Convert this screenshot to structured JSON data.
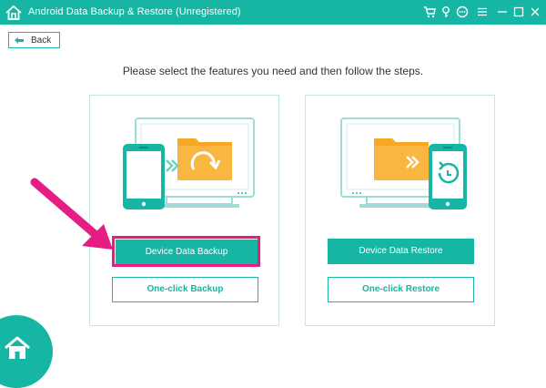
{
  "window": {
    "title": "Android Data Backup & Restore (Unregistered)"
  },
  "toolbar": {
    "back_label": "Back"
  },
  "main": {
    "instruction": "Please select the features you need and then follow the steps."
  },
  "backup_panel": {
    "primary_label": "Device Data Backup",
    "secondary_label": "One-click Backup"
  },
  "restore_panel": {
    "primary_label": "Device Data Restore",
    "secondary_label": "One-click Restore"
  },
  "colors": {
    "accent": "#17b5a4",
    "highlight": "#e51e84",
    "folder": "#f7a825"
  },
  "icons": [
    "home-icon",
    "cart-icon",
    "key-icon",
    "chat-icon",
    "menu-icon",
    "minimize-icon",
    "maximize-icon",
    "close-icon",
    "back-arrow-icon",
    "phone-icon",
    "folder-icon",
    "monitor-icon",
    "pointer-arrow"
  ]
}
